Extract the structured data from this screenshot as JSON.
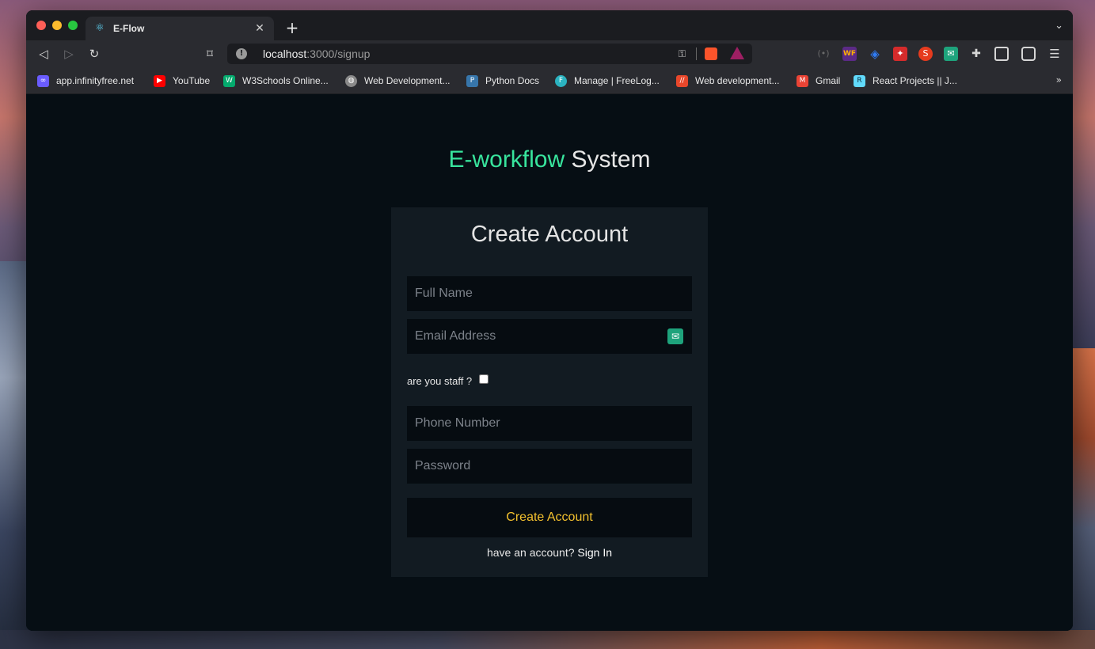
{
  "browser": {
    "tab": {
      "title": "E-Flow",
      "favicon": "react-atom-icon"
    },
    "url": {
      "host": "localhost",
      "path": ":3000/signup"
    },
    "bookmarks": [
      {
        "label": "app.infinityfree.net",
        "icon": "infinity-icon",
        "color": "#6a5cff"
      },
      {
        "label": "YouTube",
        "icon": "youtube-icon",
        "color": "#ff0000"
      },
      {
        "label": "W3Schools Online...",
        "icon": "w3schools-icon",
        "color": "#04aa6d"
      },
      {
        "label": "Web Development...",
        "icon": "globe-icon",
        "color": "#8a8a8a"
      },
      {
        "label": "Python Docs",
        "icon": "python-icon",
        "color": "#3776ab"
      },
      {
        "label": "Manage | FreeLog...",
        "icon": "freelogo-icon",
        "color": "#2bb3c0"
      },
      {
        "label": "Web development...",
        "icon": "codecademy-icon",
        "color": "#e8472b"
      },
      {
        "label": "Gmail",
        "icon": "gmail-icon",
        "color": "#ea4335"
      },
      {
        "label": "React Projects || J...",
        "icon": "react-projects-icon",
        "color": "#61dafb"
      }
    ]
  },
  "page": {
    "heading_accent": "E-workflow",
    "heading_rest": " System",
    "form": {
      "title": "Create Account",
      "full_name_placeholder": "Full Name",
      "email_placeholder": "Email Address",
      "staff_label": "are you staff ?",
      "staff_checked": false,
      "phone_placeholder": "Phone Number",
      "password_placeholder": "Password",
      "submit_label": "Create Account",
      "signin_prompt": "have an account? ",
      "signin_link": "Sign In"
    }
  },
  "colors": {
    "accent_green": "#38e49d",
    "submit_yellow": "#f2c12e",
    "page_bg": "#060e14",
    "card_bg": "#121b22"
  }
}
